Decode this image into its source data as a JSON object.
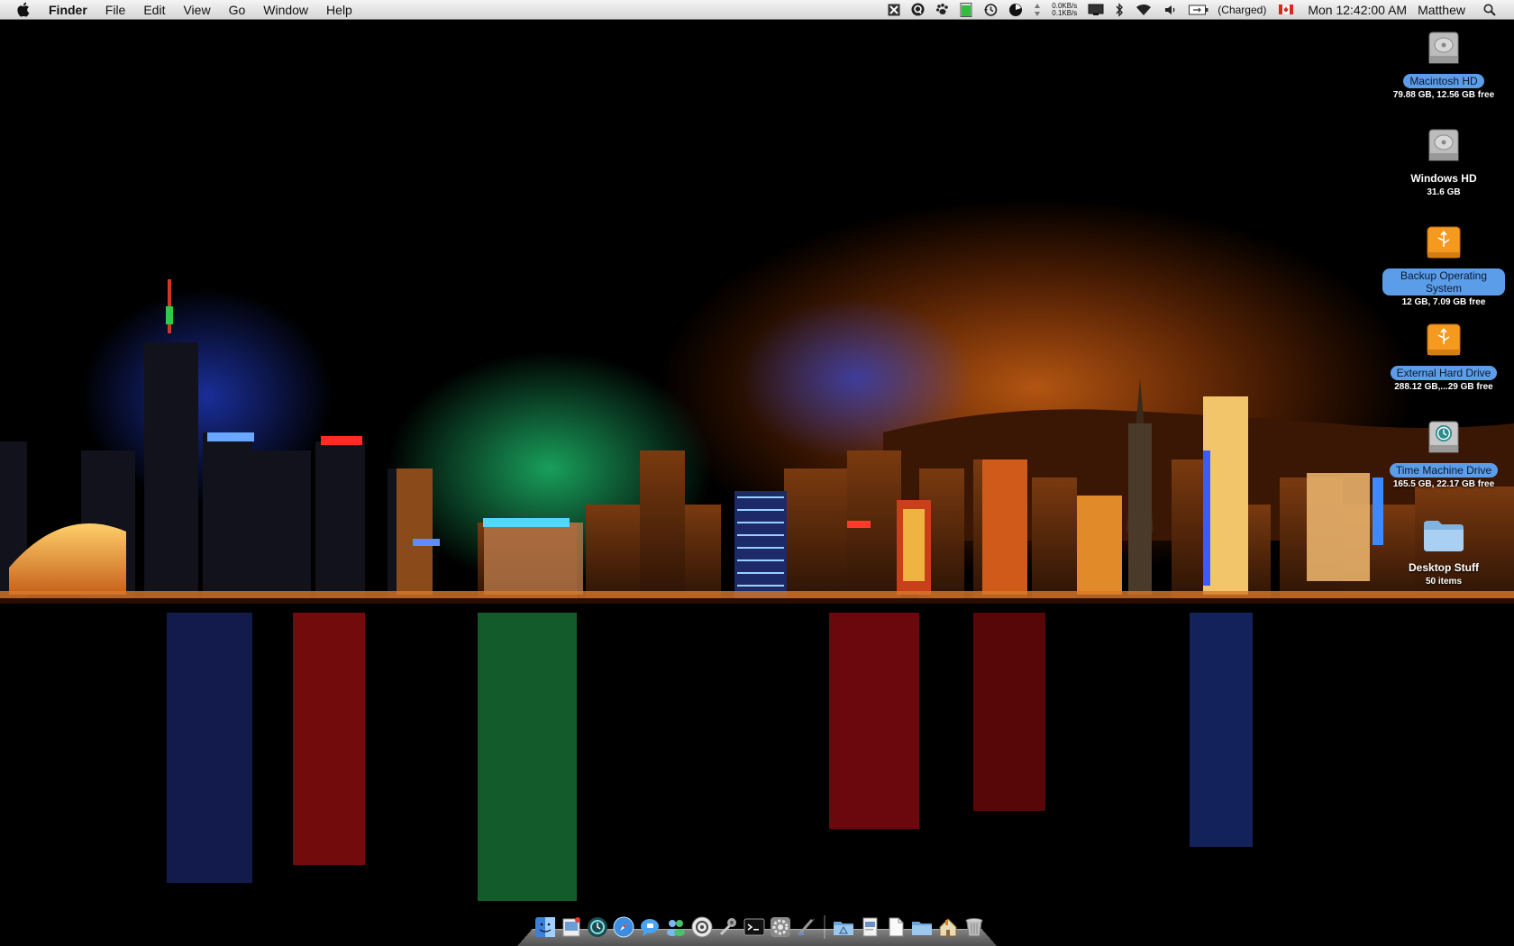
{
  "menubar": {
    "apple_icon": "apple-icon",
    "app_name": "Finder",
    "menus": [
      "File",
      "Edit",
      "View",
      "Go",
      "Window",
      "Help"
    ],
    "status_icons": [
      "x-status-icon",
      "q-status-icon",
      "paw-status-icon",
      "green-gauge-icon",
      "time-machine-icon",
      "clock-pie-icon",
      "network-arrows-icon",
      "display-icon",
      "bluetooth-icon",
      "wifi-icon",
      "volume-icon",
      "battery-icon",
      "canada-flag-icon",
      "spotlight-icon"
    ],
    "net_up": "0.0KB/s",
    "net_down": "0.1KB/s",
    "battery_status": "(Charged)",
    "clock": "Mon 12:42:00 AM",
    "user": "Matthew"
  },
  "desktop_icons": [
    {
      "name": "Macintosh HD",
      "info": "79.88 GB, 12.56 GB free",
      "icon": "internal-drive-icon",
      "selected": true
    },
    {
      "name": "Windows HD",
      "info": "31.6 GB",
      "icon": "internal-drive-icon",
      "selected": false
    },
    {
      "name": "Backup Operating System",
      "info": "12 GB, 7.09 GB free",
      "icon": "usb-drive-icon",
      "selected": true
    },
    {
      "name": "External Hard Drive",
      "info": "288.12 GB,...29 GB free",
      "icon": "usb-drive-icon",
      "selected": true
    },
    {
      "name": "Time Machine Drive",
      "info": "165.5 GB, 22.17 GB free",
      "icon": "time-machine-drive-icon",
      "selected": true
    },
    {
      "name": "Desktop Stuff",
      "info": "50 items",
      "icon": "folder-icon",
      "selected": false
    }
  ],
  "dock": {
    "apps": [
      "finder-icon",
      "preview-icon",
      "time-machine-icon",
      "safari-icon",
      "ichat-icon",
      "contacts-icon",
      "itunes-icon",
      "system-tool-icon",
      "terminal-icon",
      "system-preferences-icon",
      "script-editor-icon"
    ],
    "stacks": [
      "applications-stack-icon",
      "documents-stack-icon",
      "file-stack-icon",
      "folder-stack-icon",
      "home-stack-icon",
      "trash-icon"
    ]
  },
  "colors": {
    "menubar_top": "#f4f4f4",
    "menubar_bottom": "#d6d6d6",
    "selection": "#5b9de8",
    "wallpaper_sky": "#000000"
  }
}
